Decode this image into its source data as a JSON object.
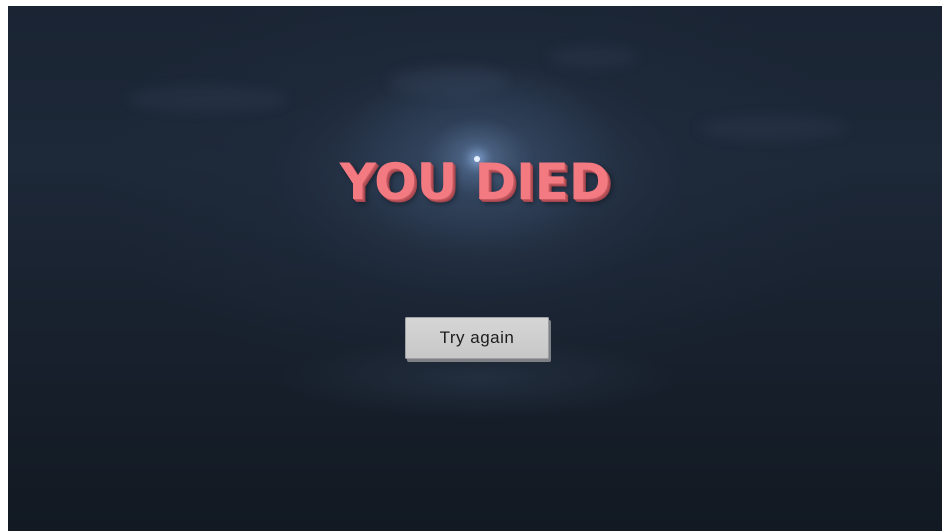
{
  "screen": {
    "title": "YOU DIED",
    "title_color": "#f47a82",
    "background_color": "#1a2433"
  },
  "actions": {
    "retry_label": "Try again"
  }
}
